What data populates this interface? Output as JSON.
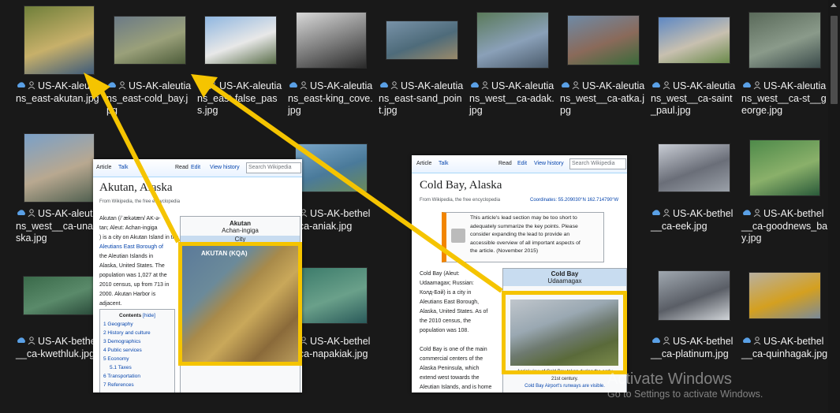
{
  "files": [
    {
      "name": "US-AK-aleutians_east-akutan.jpg",
      "colors": [
        "#6f7f3a",
        "#c7b06a",
        "#3d5a7a"
      ]
    },
    {
      "name": "US-AK-aleutians_east-cold_bay.jpg",
      "colors": [
        "#6b7a86",
        "#9aa07a",
        "#4d5c3a"
      ]
    },
    {
      "name": "US-AK-aleutians_east-false_pass.jpg",
      "colors": [
        "#8fb6e0",
        "#e8e8e8",
        "#5a6e4a"
      ]
    },
    {
      "name": "US-AK-aleutians_east-king_cove.jpg",
      "colors": [
        "#d8d8d8",
        "#7a7a7a",
        "#2a2a2a"
      ]
    },
    {
      "name": "US-AK-aleutians_east-sand_point.jpg",
      "colors": [
        "#7892a8",
        "#4e6b7a",
        "#9a8a6a"
      ]
    },
    {
      "name": "US-AK-aleutians_west__ca-adak.jpg",
      "colors": [
        "#5a7a5a",
        "#8aa0b8",
        "#4a5a6a"
      ]
    },
    {
      "name": "US-AK-aleutians_west__ca-atka.jpg",
      "colors": [
        "#6e8aa6",
        "#8a6a5a",
        "#3a6a3a"
      ]
    },
    {
      "name": "US-AK-aleutians_west__ca-saint_paul.jpg",
      "colors": [
        "#5e88c4",
        "#c8c0b0",
        "#6a8a4a"
      ]
    },
    {
      "name": "US-AK-aleutians_west__ca-st__george.jpg",
      "colors": [
        "#5a6a5a",
        "#8a9a8a",
        "#3a4a4a"
      ]
    },
    {
      "name": "US-AK-aleutians_west__ca-unalaska.jpg",
      "colors": [
        "#7aa0c8",
        "#b8a890",
        "#506050"
      ]
    },
    {
      "name": "US-AK-bethel__ca-aniak.jpg",
      "colors": [
        "#7aa6c8",
        "#4a7a9a",
        "#6a8a5a"
      ]
    },
    {
      "name": "US-AK-bethel__ca-eek.jpg",
      "colors": [
        "#c8ccd4",
        "#6a6e78",
        "#9aa0a8"
      ]
    },
    {
      "name": "US-AK-bethel__ca-goodnews_bay.jpg",
      "colors": [
        "#4e8a4a",
        "#8ab06a",
        "#2a5a3a"
      ]
    },
    {
      "name": "US-AK-bethel__ca-kwethluk.jpg",
      "colors": [
        "#3a6a4a",
        "#5a8a6a",
        "#2a4a3a"
      ]
    },
    {
      "name": "US-AK-bethel__ca-napakiak.jpg",
      "colors": [
        "#3a7a6a",
        "#6aa08a",
        "#2a5a5a"
      ]
    },
    {
      "name": "US-AK-bethel__ca-platinum.jpg",
      "colors": [
        "#a0a8b0",
        "#5a5e66",
        "#d0d4d8"
      ]
    },
    {
      "name": "US-AK-bethel__ca-quinhagak.jpg",
      "colors": [
        "#b8b0a0",
        "#d4a020",
        "#7a8a9a"
      ]
    }
  ],
  "partial_labels": {
    "aniak_left_fragment": "l.jpg",
    "napakiak_left_fragment": "ski"
  },
  "wiki_akutan": {
    "tab_article": "Article",
    "tab_talk": "Talk",
    "tab_read": "Read",
    "tab_edit": "Edit",
    "tab_history": "View history",
    "search_placeholder": "Search Wikipedia",
    "title": "Akutan, Alaska",
    "from": "From Wikipedia, the free encyclopedia",
    "intro_1": "Akutan (/ˈækətæn/ AK-ə-",
    "intro_2": "tan; Aleut: Achan-ingiga",
    "intro_3": ") is a city on Akutan Island in the",
    "intro_4": "Aleutians East Borough of",
    "intro_5": "the Aleutian Islands in",
    "intro_6": "Alaska, United States. The",
    "intro_7": "population was 1,027 at the",
    "intro_8": "2010 census, up from 713 in",
    "intro_9": "2000. Akutan Harbor is",
    "intro_10": "adjacent.",
    "infobox_title": "Akutan",
    "infobox_subtitle": "Achan-ingiga",
    "infobox_type": "City",
    "contents_title": "Contents",
    "contents_hide": "[hide]",
    "contents": [
      "1 Geography",
      "2 History and culture",
      "3 Demographics",
      "4 Public services",
      "5 Economy",
      "5.1 Taxes",
      "6 Transportation",
      "7 References"
    ],
    "map_caption": "AKUTAN (KQA)"
  },
  "wiki_coldbay": {
    "tab_article": "Article",
    "tab_talk": "Talk",
    "tab_read": "Read",
    "tab_edit": "Edit",
    "tab_history": "View history",
    "search_placeholder": "Search Wikipedia",
    "title": "Cold Bay, Alaska",
    "from": "From Wikipedia, the free encyclopedia",
    "coordinates": "Coordinates: 55.209030°N 162.714790°W",
    "notice_1": "This article's lead section may be too short to",
    "notice_2": "adequately summarize the key points. Please",
    "notice_3": "consider expanding the lead to provide an",
    "notice_4": "accessible overview of all important aspects of",
    "notice_5": "the article. (November 2015)",
    "infobox_title": "Cold Bay",
    "infobox_subtitle": "Udaamagax",
    "body": [
      "Cold Bay (Aleut:",
      "Udaamagax; Russian:",
      "Колд-Бэй) is a city in",
      "Aleutians East Borough,",
      "Alaska, United States. As of",
      "the 2010 census, the",
      "population was 108.",
      "",
      "Cold Bay is one of the main",
      "commercial centers of the",
      "Alaska Peninsula, which",
      "extend west towards the",
      "Aleutian Islands, and is home",
      "to Cold Bay Airport."
    ],
    "caption_1": "Aerial view of Cold Bay taken during the early",
    "caption_2": "21st century.",
    "caption_3": "Cold Bay Airport's runways are visible."
  },
  "watermark": {
    "line1": "Activate Windows",
    "line2": "Go to Settings to activate Windows."
  },
  "highlight_color": "#f5c400",
  "arrow_color": "#f5c400"
}
